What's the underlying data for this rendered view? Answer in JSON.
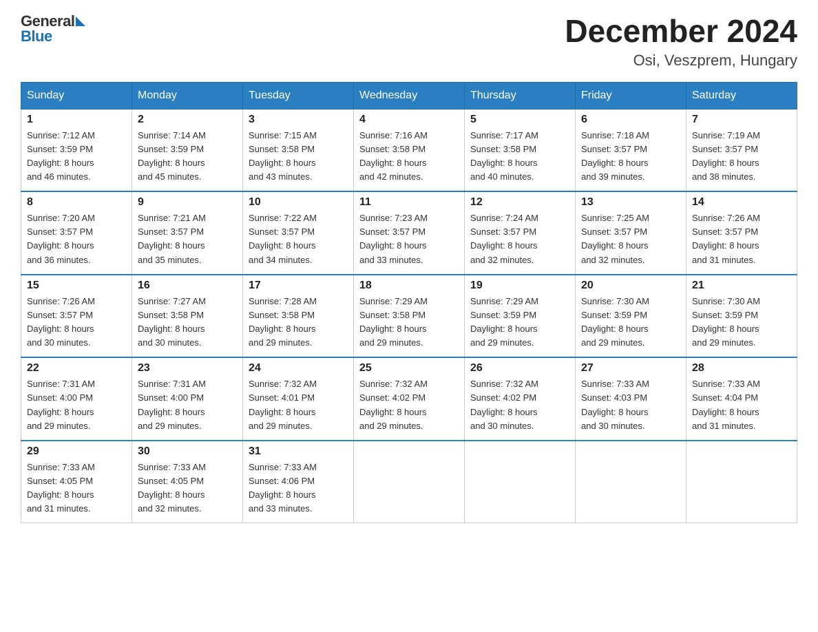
{
  "header": {
    "logo_general": "General",
    "logo_blue": "Blue",
    "title": "December 2024",
    "subtitle": "Osi, Veszprem, Hungary"
  },
  "weekdays": [
    "Sunday",
    "Monday",
    "Tuesday",
    "Wednesday",
    "Thursday",
    "Friday",
    "Saturday"
  ],
  "weeks": [
    [
      {
        "day": "1",
        "sunrise": "7:12 AM",
        "sunset": "3:59 PM",
        "daylight": "8 hours and 46 minutes."
      },
      {
        "day": "2",
        "sunrise": "7:14 AM",
        "sunset": "3:59 PM",
        "daylight": "8 hours and 45 minutes."
      },
      {
        "day": "3",
        "sunrise": "7:15 AM",
        "sunset": "3:58 PM",
        "daylight": "8 hours and 43 minutes."
      },
      {
        "day": "4",
        "sunrise": "7:16 AM",
        "sunset": "3:58 PM",
        "daylight": "8 hours and 42 minutes."
      },
      {
        "day": "5",
        "sunrise": "7:17 AM",
        "sunset": "3:58 PM",
        "daylight": "8 hours and 40 minutes."
      },
      {
        "day": "6",
        "sunrise": "7:18 AM",
        "sunset": "3:57 PM",
        "daylight": "8 hours and 39 minutes."
      },
      {
        "day": "7",
        "sunrise": "7:19 AM",
        "sunset": "3:57 PM",
        "daylight": "8 hours and 38 minutes."
      }
    ],
    [
      {
        "day": "8",
        "sunrise": "7:20 AM",
        "sunset": "3:57 PM",
        "daylight": "8 hours and 36 minutes."
      },
      {
        "day": "9",
        "sunrise": "7:21 AM",
        "sunset": "3:57 PM",
        "daylight": "8 hours and 35 minutes."
      },
      {
        "day": "10",
        "sunrise": "7:22 AM",
        "sunset": "3:57 PM",
        "daylight": "8 hours and 34 minutes."
      },
      {
        "day": "11",
        "sunrise": "7:23 AM",
        "sunset": "3:57 PM",
        "daylight": "8 hours and 33 minutes."
      },
      {
        "day": "12",
        "sunrise": "7:24 AM",
        "sunset": "3:57 PM",
        "daylight": "8 hours and 32 minutes."
      },
      {
        "day": "13",
        "sunrise": "7:25 AM",
        "sunset": "3:57 PM",
        "daylight": "8 hours and 32 minutes."
      },
      {
        "day": "14",
        "sunrise": "7:26 AM",
        "sunset": "3:57 PM",
        "daylight": "8 hours and 31 minutes."
      }
    ],
    [
      {
        "day": "15",
        "sunrise": "7:26 AM",
        "sunset": "3:57 PM",
        "daylight": "8 hours and 30 minutes."
      },
      {
        "day": "16",
        "sunrise": "7:27 AM",
        "sunset": "3:58 PM",
        "daylight": "8 hours and 30 minutes."
      },
      {
        "day": "17",
        "sunrise": "7:28 AM",
        "sunset": "3:58 PM",
        "daylight": "8 hours and 29 minutes."
      },
      {
        "day": "18",
        "sunrise": "7:29 AM",
        "sunset": "3:58 PM",
        "daylight": "8 hours and 29 minutes."
      },
      {
        "day": "19",
        "sunrise": "7:29 AM",
        "sunset": "3:59 PM",
        "daylight": "8 hours and 29 minutes."
      },
      {
        "day": "20",
        "sunrise": "7:30 AM",
        "sunset": "3:59 PM",
        "daylight": "8 hours and 29 minutes."
      },
      {
        "day": "21",
        "sunrise": "7:30 AM",
        "sunset": "3:59 PM",
        "daylight": "8 hours and 29 minutes."
      }
    ],
    [
      {
        "day": "22",
        "sunrise": "7:31 AM",
        "sunset": "4:00 PM",
        "daylight": "8 hours and 29 minutes."
      },
      {
        "day": "23",
        "sunrise": "7:31 AM",
        "sunset": "4:00 PM",
        "daylight": "8 hours and 29 minutes."
      },
      {
        "day": "24",
        "sunrise": "7:32 AM",
        "sunset": "4:01 PM",
        "daylight": "8 hours and 29 minutes."
      },
      {
        "day": "25",
        "sunrise": "7:32 AM",
        "sunset": "4:02 PM",
        "daylight": "8 hours and 29 minutes."
      },
      {
        "day": "26",
        "sunrise": "7:32 AM",
        "sunset": "4:02 PM",
        "daylight": "8 hours and 30 minutes."
      },
      {
        "day": "27",
        "sunrise": "7:33 AM",
        "sunset": "4:03 PM",
        "daylight": "8 hours and 30 minutes."
      },
      {
        "day": "28",
        "sunrise": "7:33 AM",
        "sunset": "4:04 PM",
        "daylight": "8 hours and 31 minutes."
      }
    ],
    [
      {
        "day": "29",
        "sunrise": "7:33 AM",
        "sunset": "4:05 PM",
        "daylight": "8 hours and 31 minutes."
      },
      {
        "day": "30",
        "sunrise": "7:33 AM",
        "sunset": "4:05 PM",
        "daylight": "8 hours and 32 minutes."
      },
      {
        "day": "31",
        "sunrise": "7:33 AM",
        "sunset": "4:06 PM",
        "daylight": "8 hours and 33 minutes."
      },
      null,
      null,
      null,
      null
    ]
  ],
  "labels": {
    "sunrise": "Sunrise:",
    "sunset": "Sunset:",
    "daylight": "Daylight:"
  }
}
